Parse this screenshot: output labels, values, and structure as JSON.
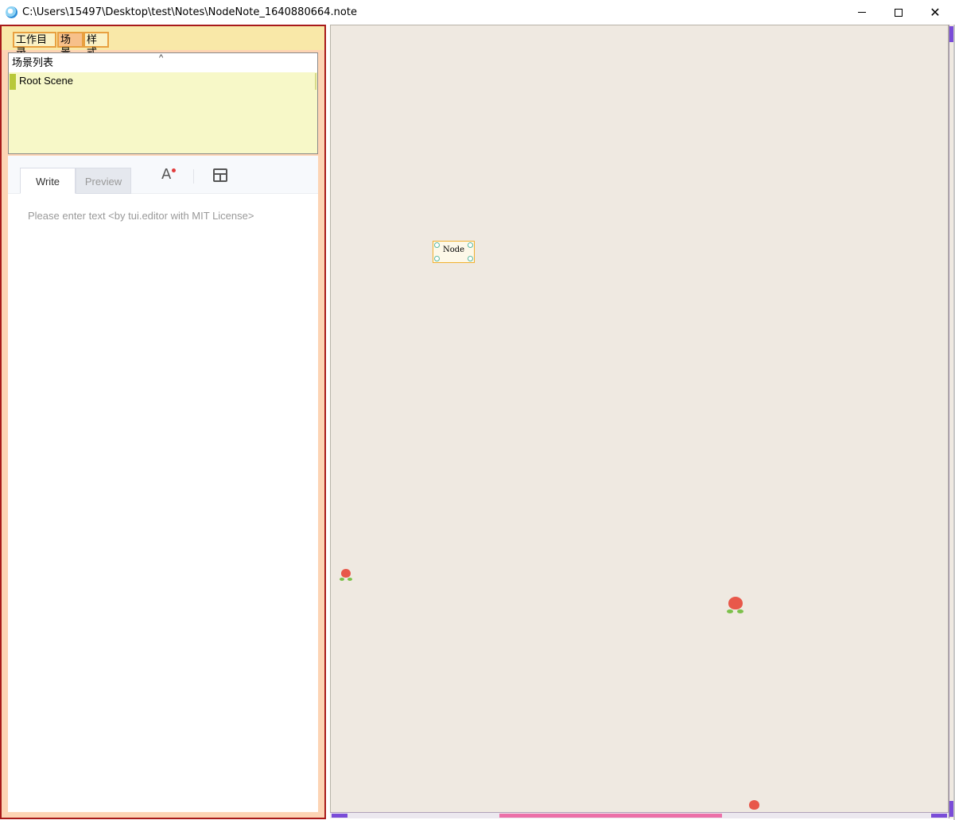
{
  "window": {
    "title": "C:\\Users\\15497\\Desktop\\test\\Notes\\NodeNote_1640880664.note",
    "minimize_icon": "minimize-icon",
    "maximize_icon": "maximize-icon",
    "close_label": "✕"
  },
  "sidebar": {
    "tabs": [
      "工作目录",
      "场景",
      "样式"
    ],
    "active_tab": "场景",
    "scene_list": {
      "header": "场景列表",
      "collapse_glyph": "^",
      "items": [
        "Root Scene"
      ]
    }
  },
  "editor": {
    "tabs": {
      "write": "Write",
      "preview": "Preview"
    },
    "font_icon_glyph": "A",
    "placeholder": "Please enter text <by tui.editor with MIT License>"
  },
  "canvas": {
    "node_label": "Node",
    "colors": {
      "background": "#efe9e1",
      "node_border": "#f0b030",
      "flower": "#e8584a",
      "scroll_thumb": "#ec70a8"
    }
  }
}
